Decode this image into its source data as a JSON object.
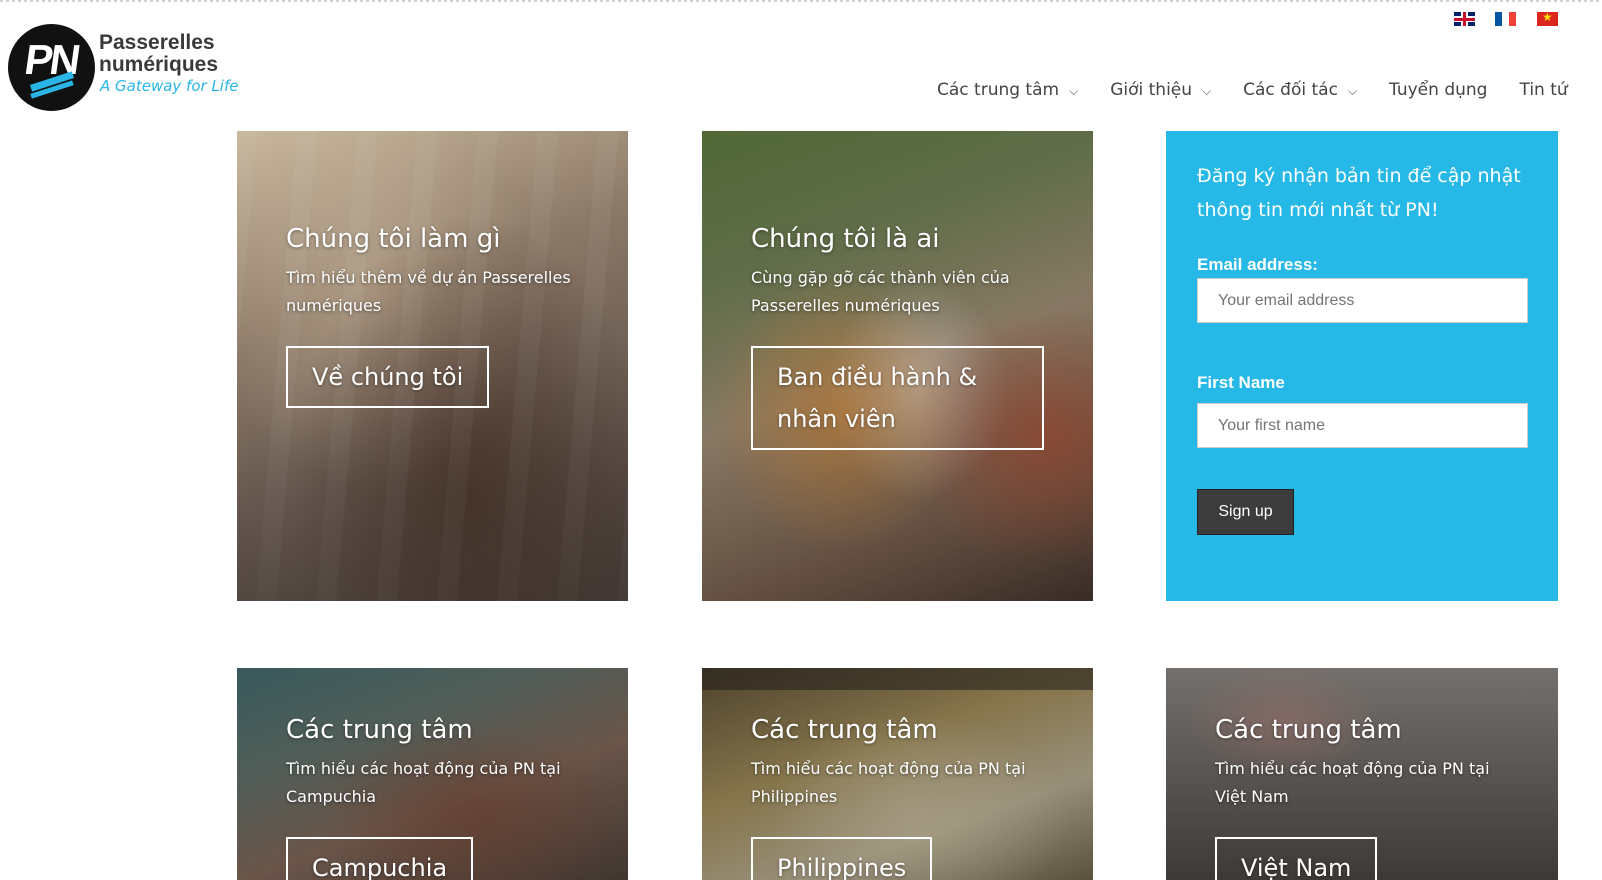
{
  "header": {
    "logo": {
      "name_line1": "Passerelles",
      "name_line2": "numériques",
      "tagline": "A Gateway for Life",
      "mark": "PN"
    },
    "languages": [
      {
        "code": "en",
        "icon": "uk-flag-icon"
      },
      {
        "code": "fr",
        "icon": "france-flag-icon"
      },
      {
        "code": "vi",
        "icon": "vietnam-flag-icon"
      }
    ],
    "nav": [
      {
        "label": "Các trung tâm",
        "dropdown": true
      },
      {
        "label": "Giới thiệu",
        "dropdown": true
      },
      {
        "label": "Các đối tác",
        "dropdown": true
      },
      {
        "label": "Tuyển dụng",
        "dropdown": false
      },
      {
        "label": "Tin tứ",
        "dropdown": false
      }
    ]
  },
  "tiles": [
    {
      "title": "Chúng tôi làm gì",
      "text": "Tìm hiểu thêm về dự án Passerelles numériques",
      "button": "Về chúng tôi"
    },
    {
      "title": "Chúng tôi là ai",
      "text": "Cùng gặp gỡ các thành viên của Passerelles numériques",
      "button": "Ban điều hành & nhân viên"
    }
  ],
  "centers": [
    {
      "title": "Các trung tâm",
      "text": "Tìm hiểu các hoạt động của PN tại Campuchia",
      "button": "Campuchia"
    },
    {
      "title": "Các trung tâm",
      "text": "Tìm hiểu các hoạt động của PN tại Philippines",
      "button": "Philippines"
    },
    {
      "title": "Các trung tâm",
      "text": "Tìm hiểu các hoạt động của PN tại Việt Nam",
      "button": "Việt Nam"
    }
  ],
  "newsletter": {
    "intro": "Đăng ký nhận bản tin để cập nhật thông tin mới nhất từ PN!",
    "email_label": "Email address:",
    "email_placeholder": "Your email address",
    "firstname_label": "First Name",
    "firstname_placeholder": "Your first name",
    "submit_label": "Sign up",
    "background": "#26b8e6"
  }
}
